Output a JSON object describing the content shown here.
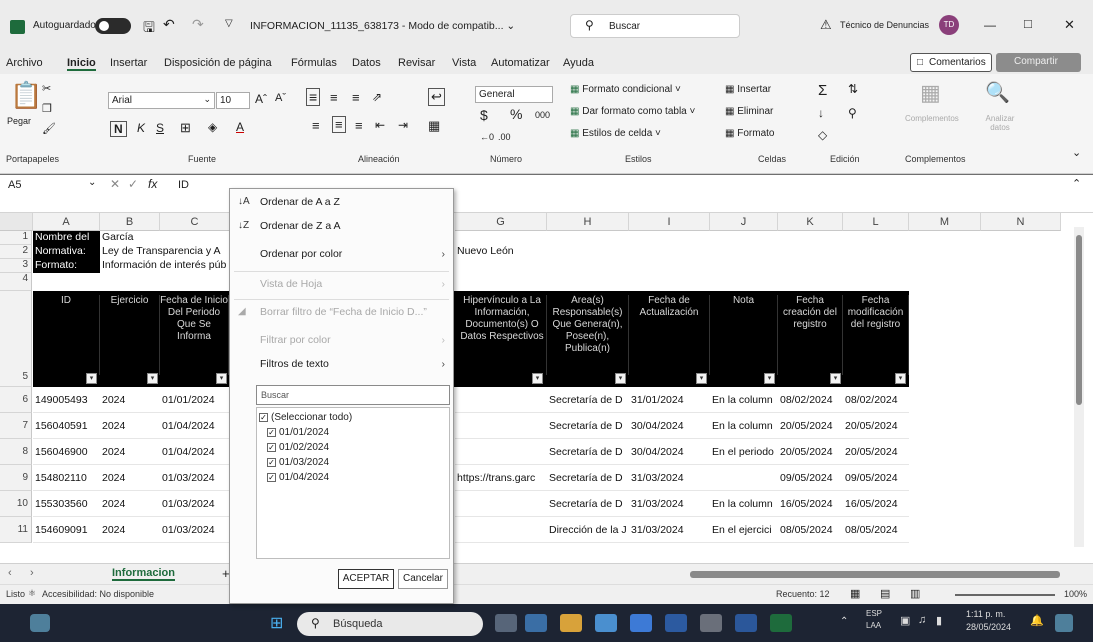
{
  "titlebar": {
    "autosave_label": "Autoguardado",
    "filename": "INFORMACION_11135_638173 - Modo de compatib... ⌄",
    "search_placeholder": "Buscar",
    "user": "Técnico de Denuncias",
    "user_initials": "TD",
    "minimize": "—",
    "restore": "□",
    "close": "✕"
  },
  "menubar": {
    "items": [
      "Archivo",
      "Inicio",
      "Insertar",
      "Disposición de página",
      "Fórmulas",
      "Datos",
      "Revisar",
      "Vista",
      "Automatizar",
      "Ayuda"
    ],
    "comments": "Comentarios",
    "share": "Compartir"
  },
  "ribbon": {
    "paste": "Pegar",
    "clipboard_group": "Portapapeles",
    "font_name": "Arial",
    "font_size": "10",
    "font_group": "Fuente",
    "alignment_group": "Alineación",
    "number_format": "General",
    "number_group": "Número",
    "cond_format": "Formato condicional ˅",
    "table_format": "Dar formato como tabla ˅",
    "cell_styles": "Estilos de celda ˅",
    "styles_group": "Estilos",
    "insert": "Insertar",
    "delete": "Eliminar",
    "format": "Formato",
    "cells_group": "Celdas",
    "edit_group": "Edición",
    "complements": "Complementos",
    "analyze": "Analizar datos",
    "complements_group": "Complementos"
  },
  "formula": {
    "namebox": "A5",
    "value": "ID"
  },
  "columns": [
    "A",
    "B",
    "C",
    "D",
    "E",
    "F",
    "G",
    "H",
    "I",
    "J",
    "K",
    "L",
    "M",
    "N"
  ],
  "rows": {
    "r1": {
      "label": "Nombre del",
      "value": "García"
    },
    "r2": {
      "label": "Normativa:",
      "value": "Ley de Transparencia y A",
      "extra": "Nuevo León"
    },
    "r3": {
      "label": "Formato:",
      "value": "Información de interés púb"
    }
  },
  "headers": {
    "id": "ID",
    "ejercicio": "Ejercicio",
    "fecha_inicio": "Fecha de Inicio Del Periodo Que Se Informa",
    "hipervinculo": "Hipervínculo a La Información, Documento(s) O Datos Respectivos",
    "area": "Área(s) Responsable(s) Que Genera(n), Posee(n), Publica(n)",
    "fecha_act": "Fecha de Actualización",
    "nota": "Nota",
    "fecha_creacion": "Fecha creación del registro",
    "fecha_mod": "Fecha modificación del registro"
  },
  "data_rows": [
    {
      "row": "6",
      "id": "149005493",
      "ej": "2024",
      "fi": "01/01/2024",
      "hip": "",
      "area": "Secretaría de D",
      "fa": "31/01/2024",
      "nota": "En la column",
      "fc": "08/02/2024",
      "fm": "08/02/2024"
    },
    {
      "row": "7",
      "id": "156040591",
      "ej": "2024",
      "fi": "01/04/2024",
      "hip": "",
      "area": "Secretaría de D",
      "fa": "30/04/2024",
      "nota": "En la column",
      "fc": "20/05/2024",
      "fm": "20/05/2024"
    },
    {
      "row": "8",
      "id": "156046900",
      "ej": "2024",
      "fi": "01/04/2024",
      "hip": "",
      "area": "Secretaría de D",
      "fa": "30/04/2024",
      "nota": "En el periodo",
      "fc": "20/05/2024",
      "fm": "20/05/2024"
    },
    {
      "row": "9",
      "id": "154802110",
      "ej": "2024",
      "fi": "01/03/2024",
      "hip": "https://trans.garc",
      "area": "Secretaría de D",
      "fa": "31/03/2024",
      "nota": "",
      "fc": "09/05/2024",
      "fm": "09/05/2024"
    },
    {
      "row": "10",
      "id": "155303560",
      "ej": "2024",
      "fi": "01/03/2024",
      "hip": "",
      "area": "Secretaría de D",
      "fa": "31/03/2024",
      "nota": "En la column",
      "fc": "16/05/2024",
      "fm": "16/05/2024"
    },
    {
      "row": "11",
      "id": "154609091",
      "ej": "2024",
      "fi": "01/03/2024",
      "hip": "",
      "area": "Dirección de la J",
      "fa": "31/03/2024",
      "nota": "En el ejercici",
      "fc": "08/05/2024",
      "fm": "08/05/2024"
    }
  ],
  "filter_menu": {
    "sort_az": "Ordenar de A a Z",
    "sort_za": "Ordenar de Z a A",
    "sort_color": "Ordenar por color",
    "sheet_view": "Vista de Hoja",
    "clear_filter": "Borrar filtro de “Fecha de Inicio D...”",
    "filter_color": "Filtrar por color",
    "text_filters": "Filtros de texto",
    "search_placeholder": "Buscar",
    "options": [
      "(Seleccionar todo)",
      "01/01/2024",
      "01/02/2024",
      "01/03/2024",
      "01/04/2024"
    ],
    "ok": "ACEPTAR",
    "cancel": "Cancelar"
  },
  "sheet": {
    "tab": "Informacion",
    "add": "+"
  },
  "status": {
    "ready": "Listo",
    "accessibility": "Accesibilidad: No disponible",
    "count": "Recuento: 12",
    "zoom": "100%"
  },
  "taskbar": {
    "search": "Búsqueda",
    "lang1": "ESP",
    "lang2": "LAA",
    "time": "1:11 p. m.",
    "date": "28/05/2024"
  }
}
